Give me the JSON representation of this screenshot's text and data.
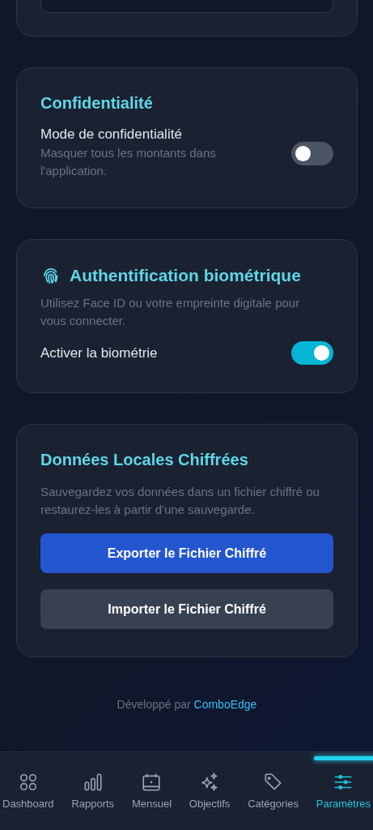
{
  "privacy": {
    "title": "Confidentialité",
    "setting": {
      "label": "Mode de confidentialité",
      "description": "Masquer tous les montants dans l'application.",
      "on": false
    }
  },
  "biometric": {
    "title": "Authentification biométrique",
    "description": "Utilisez Face ID ou votre empreinte digitale pour vous connecter.",
    "setting": {
      "label": "Activer la biométrie",
      "on": true
    }
  },
  "local_data": {
    "title": "Données Locales Chiffrées",
    "description": "Sauvegardez vos données dans un fichier chiffré ou restaurez-les à partir d'une sauvegarde.",
    "buttons": [
      {
        "label": "Exporter le Fichier Chiffré",
        "kind": "primary"
      },
      {
        "label": "Importer le Fichier Chiffré",
        "kind": "secondary"
      }
    ]
  },
  "footer": {
    "text": "Développé par",
    "link": "ComboEdge"
  },
  "nav": [
    {
      "label": "Dashboard",
      "selected": false
    },
    {
      "label": "Rapports",
      "selected": false
    },
    {
      "label": "Mensuel",
      "selected": false
    },
    {
      "label": "Objectifs",
      "selected": false
    },
    {
      "label": "Catégories",
      "selected": false
    },
    {
      "label": "Paramètres",
      "selected": true
    }
  ]
}
